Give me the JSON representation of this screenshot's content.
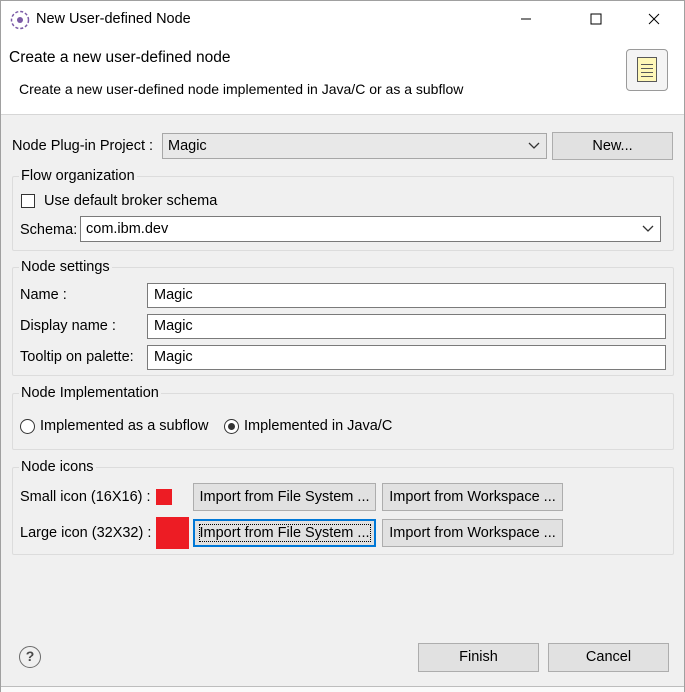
{
  "window": {
    "title": "New User-defined Node"
  },
  "header": {
    "title": "Create a new user-defined node",
    "description": "Create a new user-defined node implemented in Java/C or as a subflow"
  },
  "project": {
    "label": "Node Plug-in Project :",
    "value": "Magic",
    "new_button": "New..."
  },
  "flow_org": {
    "title": "Flow organization",
    "default_schema_label": "Use default broker schema",
    "default_schema_checked": false,
    "schema_label": "Schema:",
    "schema_value": "com.ibm.dev"
  },
  "node_settings": {
    "title": "Node settings",
    "name_label": "Name :",
    "name_value": "Magic",
    "display_label": "Display name :",
    "display_value": "Magic",
    "tooltip_label": "Tooltip on palette:",
    "tooltip_value": "Magic"
  },
  "implementation": {
    "title": "Node Implementation",
    "subflow_label": "Implemented as a subflow",
    "java_label": "Implemented in Java/C",
    "selected": "java"
  },
  "icons": {
    "title": "Node icons",
    "small_label": "Small icon (16X16) :",
    "large_label": "Large icon (32X32) :",
    "import_fs": "Import from File System ...",
    "import_ws": "Import from Workspace ...",
    "swatch_color": "#ed1c24"
  },
  "footer": {
    "help": "?",
    "finish": "Finish",
    "cancel": "Cancel"
  }
}
